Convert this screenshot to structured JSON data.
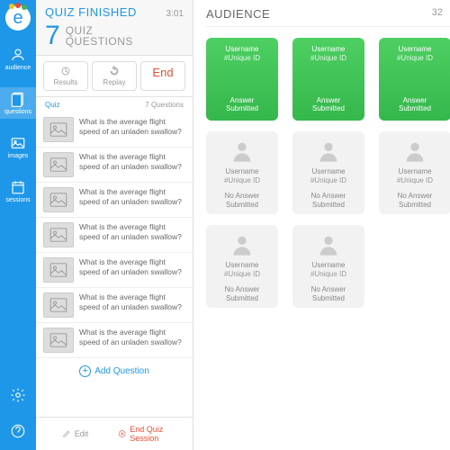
{
  "sidebar": {
    "items": [
      {
        "label": "audience"
      },
      {
        "label": "questions"
      },
      {
        "label": "images"
      },
      {
        "label": "sessions"
      }
    ]
  },
  "quiz": {
    "status": "QUIZ FINISHED",
    "time": "3:01",
    "count": "7",
    "count_label": "QUIZ\nQUESTIONS",
    "sub1": "QUIZ",
    "sub2": "QUESTIONS",
    "buttons": {
      "results": "Results",
      "replay": "Replay",
      "end": "End"
    },
    "meta_left": "Quiz",
    "meta_right": "7 Questions",
    "question_text": "What is the average flight speed of an unladen swallow?",
    "add": "Add Question",
    "footer": {
      "edit": "Edit",
      "end": "End Quiz Session"
    }
  },
  "audience": {
    "title": "AUDIENCE",
    "count": "32",
    "card": {
      "username": "Username",
      "unique_id": "#Unique ID",
      "answered": "Answer\nSubmitted",
      "ans1": "Answer",
      "ans2": "Submitted",
      "no1": "No Answer",
      "no2": "Submitted"
    }
  }
}
